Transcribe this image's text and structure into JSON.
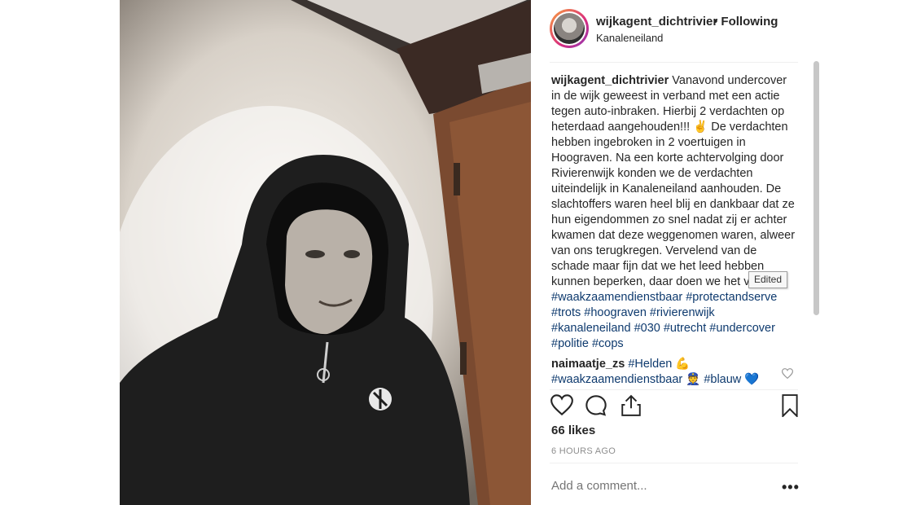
{
  "post": {
    "username": "wijkagent_dichtrivier",
    "follow_status": "• Following",
    "location": "Kanaleneiland",
    "caption_text": "Vanavond undercover in de wijk geweest in verband met een actie tegen auto-inbraken. Hierbij 2 verdachten op heterdaad aangehouden!!! ✌️ De verdachten hebben ingebroken in 2 voertuigen in Hoograven. Na een korte achtervolging door Rivierenwijk konden we de verdachten uiteindelijk in Kanaleneiland aanhouden. De slachtoffers waren heel blij en dankbaar dat ze hun eigendommen zo snel nadat zij er achter kwamen dat deze weggenomen waren, alweer van ons terugkregen. Vervelend van de schade maar fijn dat we het leed hebben kunnen beperken, daar doen we het voor!!!",
    "hashtags": "#waakzaamendienstbaar #protectandserve #trots #hoograven #rivierenwijk #kanaleneiland #030 #utrecht #undercover #politie #cops",
    "edited_tooltip": "Edited"
  },
  "comment": {
    "username": "naimaatje_zs",
    "text_prefix": "#Helden 💪",
    "text_line2": "#waakzaamendienstbaar 👮 #blauw 💙"
  },
  "stats": {
    "likes": "66 likes",
    "time": "6 HOURS AGO"
  },
  "composer": {
    "placeholder": "Add a comment...",
    "more": "•••"
  },
  "icons": {
    "like": "heart-icon",
    "comment": "comment-icon",
    "share": "share-icon",
    "save": "bookmark-icon",
    "comment_like": "heart-icon"
  }
}
